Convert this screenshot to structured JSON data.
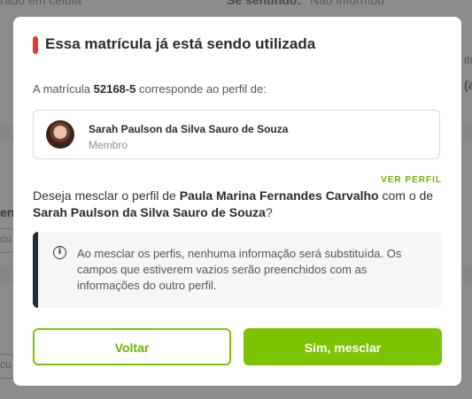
{
  "background": {
    "top_left_fragment": "rado em celula",
    "top_mid_label": "Se sentindo:",
    "top_right_value": "Não informou",
    "right_fragment_1": "ite",
    "right_fragment_2": "(a",
    "left_fragment": "en",
    "left_box_fragment": "cu"
  },
  "modal": {
    "title": "Essa matrícula já está sendo utilizada",
    "description_prefix": "A matrícula ",
    "registration_number": "52168-5",
    "description_suffix": " corresponde ao perfil de:",
    "profile": {
      "name": "Sarah Paulson da Silva Sauro de Souza",
      "role": "Membro"
    },
    "view_profile_link": "VER PERFIL",
    "question_prefix": "Deseja mesclar o perfil de ",
    "question_source_name": "Paula Marina Fernandes Carvalho",
    "question_middle": " com o de ",
    "question_target_name": "Sarah Paulson da Silva Sauro de Souza",
    "question_suffix": "?",
    "info_icon": "info-icon",
    "info_text": "Ao mesclar os perfis, nenhuma informação será substituída. Os campos que estiverem vazios serão preenchidos com as informações do outro perfil.",
    "back_button": "Voltar",
    "merge_button": "Sim, mesclar"
  },
  "colors": {
    "accent_green": "#7cc300",
    "title_marker_red": "#e53935",
    "info_border_dark": "#1f2f3d"
  }
}
